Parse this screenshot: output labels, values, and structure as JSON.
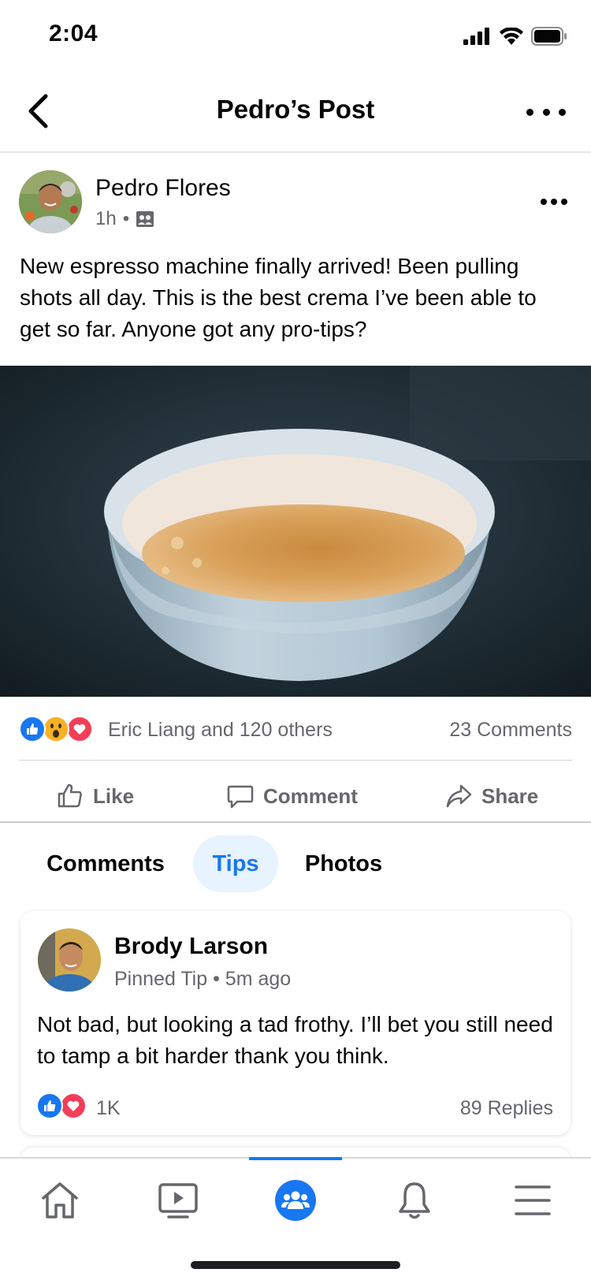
{
  "status_bar": {
    "time": "2:04"
  },
  "header": {
    "title": "Pedro’s Post"
  },
  "post": {
    "author": "Pedro Flores",
    "time": "1h",
    "separator": "•",
    "text": "New espresso machine finally arrived! Been pulling shots all day. This is the best crema I’ve been able to get so far. Anyone got any pro-tips?",
    "photo_icon": "espresso-cup-photo",
    "reactions": {
      "icons": [
        "like-icon",
        "wow-icon",
        "love-icon"
      ],
      "summary": "Eric Liang and 120 others",
      "comments": "23 Comments"
    }
  },
  "actions": {
    "like": "Like",
    "comment": "Comment",
    "share": "Share"
  },
  "tabs": [
    {
      "label": "Comments",
      "active": false
    },
    {
      "label": "Tips",
      "active": true
    },
    {
      "label": "Photos",
      "active": false
    }
  ],
  "tip": {
    "author": "Brody Larson",
    "meta": "Pinned Tip • 5m ago",
    "text": "Not bad, but looking a tad frothy. I’ll bet you still need to tamp a bit harder thank you think.",
    "reaction_count": "1K",
    "replies": "89 Replies"
  },
  "bottom_nav": {
    "items": [
      "home-icon",
      "video-icon",
      "groups-icon",
      "bell-icon",
      "menu-icon"
    ],
    "active": "groups-icon"
  },
  "colors": {
    "accent": "#1877f2",
    "secondary_text": "#65676b",
    "active_tab_bg": "#e7f3ff",
    "love": "#f33e58",
    "wow": "#f7b125"
  }
}
